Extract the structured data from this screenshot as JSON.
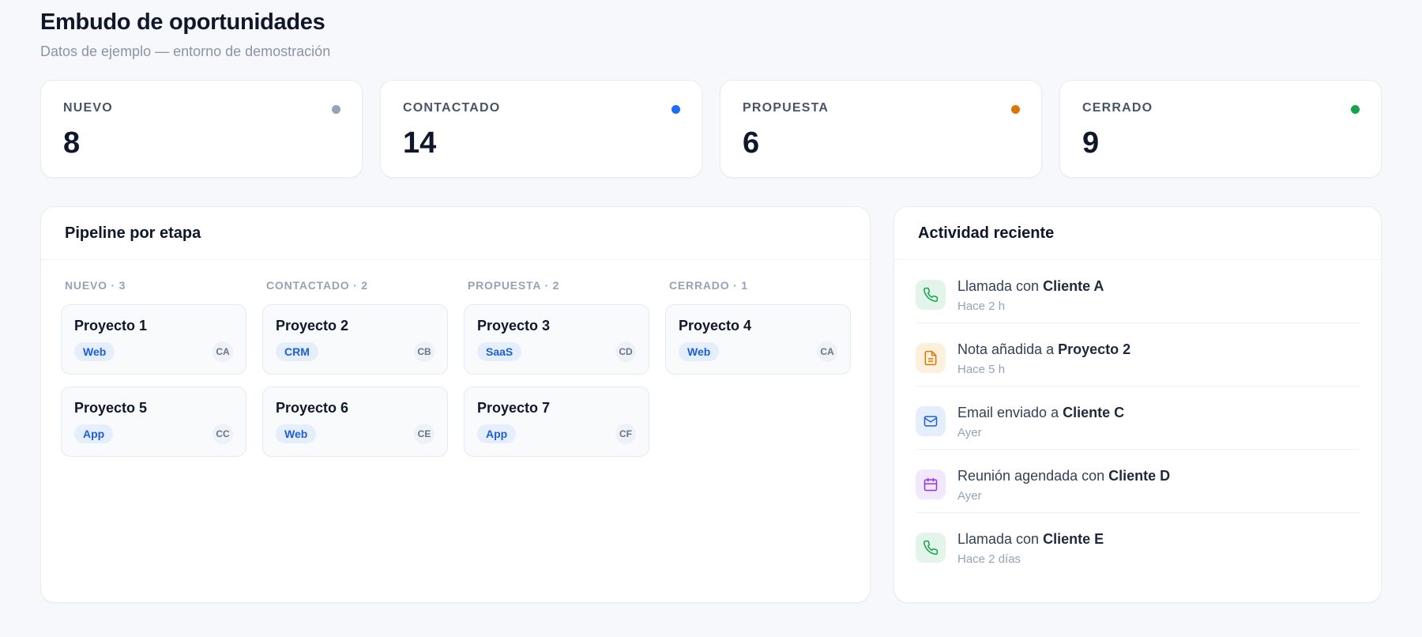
{
  "header": {
    "title": "Embudo de oportunidades",
    "subtitle": "Datos de ejemplo — entorno de demostración"
  },
  "stats": [
    {
      "label": "NUEVO",
      "value": "8",
      "color": "#94a3b8"
    },
    {
      "label": "CONTACTADO",
      "value": "14",
      "color": "#1d6ef5"
    },
    {
      "label": "PROPUESTA",
      "value": "6",
      "color": "#d97706"
    },
    {
      "label": "CERRADO",
      "value": "9",
      "color": "#16a34a"
    }
  ],
  "pipeline": {
    "title": "Pipeline por etapa",
    "columns": [
      {
        "header": "NUEVO · 3",
        "cards": [
          {
            "title": "Proyecto 1",
            "tag": "Web",
            "initials": "CA"
          },
          {
            "title": "Proyecto 5",
            "tag": "App",
            "initials": "CC"
          }
        ]
      },
      {
        "header": "CONTACTADO · 2",
        "cards": [
          {
            "title": "Proyecto 2",
            "tag": "CRM",
            "initials": "CB"
          },
          {
            "title": "Proyecto 6",
            "tag": "Web",
            "initials": "CE"
          }
        ]
      },
      {
        "header": "PROPUESTA · 2",
        "cards": [
          {
            "title": "Proyecto 3",
            "tag": "SaaS",
            "initials": "CD"
          },
          {
            "title": "Proyecto 7",
            "tag": "App",
            "initials": "CF"
          }
        ]
      },
      {
        "header": "CERRADO · 1",
        "cards": [
          {
            "title": "Proyecto 4",
            "tag": "Web",
            "initials": "CA"
          }
        ]
      }
    ]
  },
  "activity": {
    "title": "Actividad reciente",
    "items": [
      {
        "icon": "phone-icon",
        "bg": "#e3f5ea",
        "fg": "#16a34a",
        "prefix": "Llamada con ",
        "target": "Cliente A",
        "time": "Hace 2 h"
      },
      {
        "icon": "document-icon",
        "bg": "#fdf0dc",
        "fg": "#d97706",
        "prefix": "Nota añadida a ",
        "target": "Proyecto 2",
        "time": "Hace 5 h"
      },
      {
        "icon": "mail-icon",
        "bg": "#e5eefc",
        "fg": "#1d5fd6",
        "prefix": "Email enviado a ",
        "target": "Cliente C",
        "time": "Ayer"
      },
      {
        "icon": "calendar-icon",
        "bg": "#f1e8fb",
        "fg": "#9333ea",
        "prefix": "Reunión agendada con ",
        "target": "Cliente D",
        "time": "Ayer"
      },
      {
        "icon": "phone-icon",
        "bg": "#e3f5ea",
        "fg": "#16a34a",
        "prefix": "Llamada con ",
        "target": "Cliente E",
        "time": "Hace 2 días"
      }
    ]
  }
}
